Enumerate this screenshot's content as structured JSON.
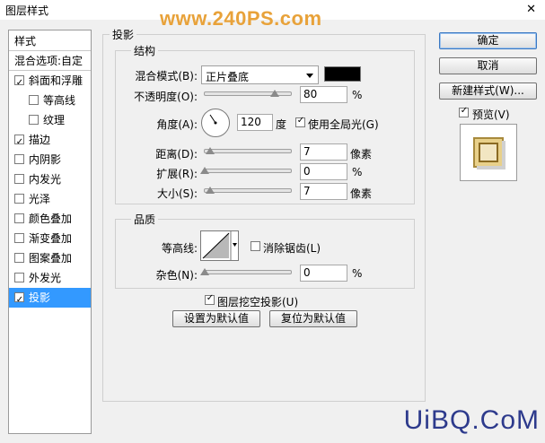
{
  "window": {
    "title": "图层样式",
    "close_glyph": "✕"
  },
  "watermark_top": "www.240PS.com",
  "watermark_bottom": "UiBQ.CoM",
  "left_panel": {
    "items": [
      {
        "label": "样式",
        "checkbox": false
      },
      {
        "label": "混合选项:自定",
        "checkbox": false
      },
      {
        "label": "斜面和浮雕",
        "checkbox": true,
        "checked": true
      },
      {
        "label": "等高线",
        "checkbox": true,
        "checked": false,
        "indent": true
      },
      {
        "label": "纹理",
        "checkbox": true,
        "checked": false,
        "indent": true
      },
      {
        "label": "描边",
        "checkbox": true,
        "checked": true
      },
      {
        "label": "内阴影",
        "checkbox": true,
        "checked": false
      },
      {
        "label": "内发光",
        "checkbox": true,
        "checked": false
      },
      {
        "label": "光泽",
        "checkbox": true,
        "checked": false
      },
      {
        "label": "颜色叠加",
        "checkbox": true,
        "checked": false
      },
      {
        "label": "渐变叠加",
        "checkbox": true,
        "checked": false
      },
      {
        "label": "图案叠加",
        "checkbox": true,
        "checked": false
      },
      {
        "label": "外发光",
        "checkbox": true,
        "checked": false
      },
      {
        "label": "投影",
        "checkbox": true,
        "checked": true,
        "selected": true
      }
    ]
  },
  "section_title": "投影",
  "structure": {
    "legend": "结构",
    "blend_mode_label": "混合模式(B):",
    "blend_mode_value": "正片叠底",
    "blend_color": "#000000",
    "opacity_label": "不透明度(O):",
    "opacity_value": "80",
    "opacity_unit": "%",
    "angle_label": "角度(A):",
    "angle_value": "120",
    "angle_unit": "度",
    "global_light_label": "使用全局光(G)",
    "global_light_checked": true,
    "distance_label": "距离(D):",
    "distance_value": "7",
    "distance_unit": "像素",
    "spread_label": "扩展(R):",
    "spread_value": "0",
    "spread_unit": "%",
    "size_label": "大小(S):",
    "size_value": "7",
    "size_unit": "像素"
  },
  "quality": {
    "legend": "品质",
    "contour_label": "等高线:",
    "antialias_label": "消除锯齿(L)",
    "antialias_checked": false,
    "noise_label": "杂色(N):",
    "noise_value": "0",
    "noise_unit": "%"
  },
  "knockout_label": "图层挖空投影(U)",
  "knockout_checked": true,
  "buttons": {
    "make_default": "设置为默认值",
    "reset_default": "复位为默认值",
    "ok": "确定",
    "cancel": "取消",
    "new_style": "新建样式(W)...",
    "preview_label": "预览(V)",
    "preview_checked": true
  }
}
